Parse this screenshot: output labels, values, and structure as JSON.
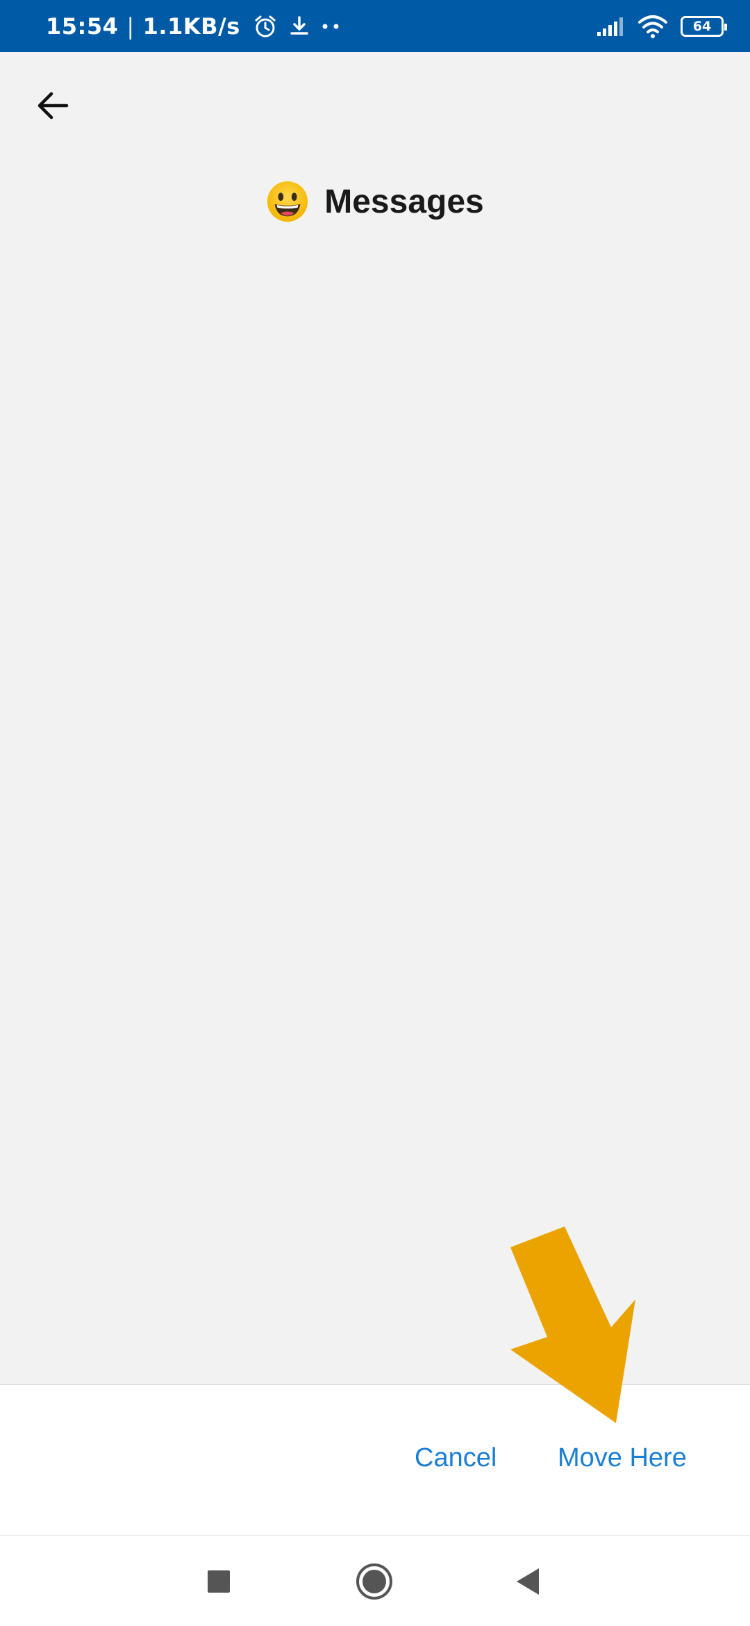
{
  "status_bar": {
    "time": "15:54",
    "separator": "|",
    "network_speed": "1.1KB/s",
    "left_icons": [
      "alarm-icon",
      "download-icon",
      "more-dots-icon"
    ],
    "right_icons": [
      "signal-icon",
      "wifi-icon",
      "battery-icon"
    ],
    "battery_level": "64",
    "background_color": "#005aa6"
  },
  "header": {
    "back_icon": "arrow-left-icon",
    "title_emoji": "grinning-face-icon",
    "title": "Messages"
  },
  "actions": {
    "cancel_label": "Cancel",
    "move_here_label": "Move Here",
    "accent_color": "#1a7fd4"
  },
  "annotation": {
    "icon": "arrow-pointer-icon",
    "color": "#eba300"
  },
  "nav_bar": {
    "recents_icon": "square-icon",
    "home_icon": "circle-icon",
    "back_icon": "triangle-back-icon"
  }
}
